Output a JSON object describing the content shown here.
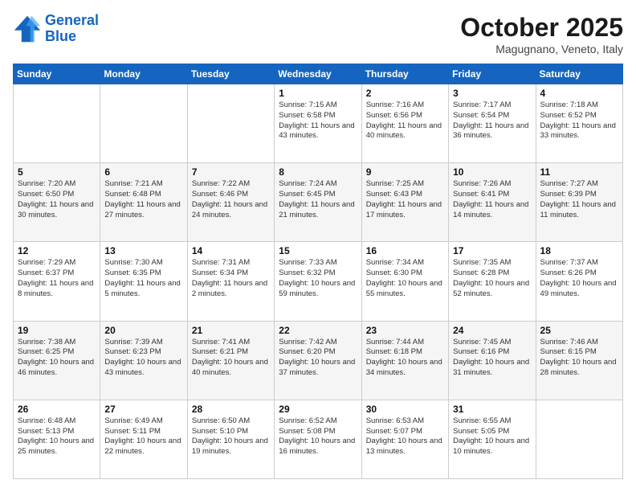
{
  "header": {
    "logo_line1": "General",
    "logo_line2": "Blue",
    "month": "October 2025",
    "location": "Magugnano, Veneto, Italy"
  },
  "weekdays": [
    "Sunday",
    "Monday",
    "Tuesday",
    "Wednesday",
    "Thursday",
    "Friday",
    "Saturday"
  ],
  "weeks": [
    [
      {
        "day": "",
        "sunrise": "",
        "sunset": "",
        "daylight": ""
      },
      {
        "day": "",
        "sunrise": "",
        "sunset": "",
        "daylight": ""
      },
      {
        "day": "",
        "sunrise": "",
        "sunset": "",
        "daylight": ""
      },
      {
        "day": "1",
        "sunrise": "7:15 AM",
        "sunset": "6:58 PM",
        "daylight": "11 hours and 43 minutes."
      },
      {
        "day": "2",
        "sunrise": "7:16 AM",
        "sunset": "6:56 PM",
        "daylight": "11 hours and 40 minutes."
      },
      {
        "day": "3",
        "sunrise": "7:17 AM",
        "sunset": "6:54 PM",
        "daylight": "11 hours and 36 minutes."
      },
      {
        "day": "4",
        "sunrise": "7:18 AM",
        "sunset": "6:52 PM",
        "daylight": "11 hours and 33 minutes."
      }
    ],
    [
      {
        "day": "5",
        "sunrise": "7:20 AM",
        "sunset": "6:50 PM",
        "daylight": "11 hours and 30 minutes."
      },
      {
        "day": "6",
        "sunrise": "7:21 AM",
        "sunset": "6:48 PM",
        "daylight": "11 hours and 27 minutes."
      },
      {
        "day": "7",
        "sunrise": "7:22 AM",
        "sunset": "6:46 PM",
        "daylight": "11 hours and 24 minutes."
      },
      {
        "day": "8",
        "sunrise": "7:24 AM",
        "sunset": "6:45 PM",
        "daylight": "11 hours and 21 minutes."
      },
      {
        "day": "9",
        "sunrise": "7:25 AM",
        "sunset": "6:43 PM",
        "daylight": "11 hours and 17 minutes."
      },
      {
        "day": "10",
        "sunrise": "7:26 AM",
        "sunset": "6:41 PM",
        "daylight": "11 hours and 14 minutes."
      },
      {
        "day": "11",
        "sunrise": "7:27 AM",
        "sunset": "6:39 PM",
        "daylight": "11 hours and 11 minutes."
      }
    ],
    [
      {
        "day": "12",
        "sunrise": "7:29 AM",
        "sunset": "6:37 PM",
        "daylight": "11 hours and 8 minutes."
      },
      {
        "day": "13",
        "sunrise": "7:30 AM",
        "sunset": "6:35 PM",
        "daylight": "11 hours and 5 minutes."
      },
      {
        "day": "14",
        "sunrise": "7:31 AM",
        "sunset": "6:34 PM",
        "daylight": "11 hours and 2 minutes."
      },
      {
        "day": "15",
        "sunrise": "7:33 AM",
        "sunset": "6:32 PM",
        "daylight": "10 hours and 59 minutes."
      },
      {
        "day": "16",
        "sunrise": "7:34 AM",
        "sunset": "6:30 PM",
        "daylight": "10 hours and 55 minutes."
      },
      {
        "day": "17",
        "sunrise": "7:35 AM",
        "sunset": "6:28 PM",
        "daylight": "10 hours and 52 minutes."
      },
      {
        "day": "18",
        "sunrise": "7:37 AM",
        "sunset": "6:26 PM",
        "daylight": "10 hours and 49 minutes."
      }
    ],
    [
      {
        "day": "19",
        "sunrise": "7:38 AM",
        "sunset": "6:25 PM",
        "daylight": "10 hours and 46 minutes."
      },
      {
        "day": "20",
        "sunrise": "7:39 AM",
        "sunset": "6:23 PM",
        "daylight": "10 hours and 43 minutes."
      },
      {
        "day": "21",
        "sunrise": "7:41 AM",
        "sunset": "6:21 PM",
        "daylight": "10 hours and 40 minutes."
      },
      {
        "day": "22",
        "sunrise": "7:42 AM",
        "sunset": "6:20 PM",
        "daylight": "10 hours and 37 minutes."
      },
      {
        "day": "23",
        "sunrise": "7:44 AM",
        "sunset": "6:18 PM",
        "daylight": "10 hours and 34 minutes."
      },
      {
        "day": "24",
        "sunrise": "7:45 AM",
        "sunset": "6:16 PM",
        "daylight": "10 hours and 31 minutes."
      },
      {
        "day": "25",
        "sunrise": "7:46 AM",
        "sunset": "6:15 PM",
        "daylight": "10 hours and 28 minutes."
      }
    ],
    [
      {
        "day": "26",
        "sunrise": "6:48 AM",
        "sunset": "5:13 PM",
        "daylight": "10 hours and 25 minutes."
      },
      {
        "day": "27",
        "sunrise": "6:49 AM",
        "sunset": "5:11 PM",
        "daylight": "10 hours and 22 minutes."
      },
      {
        "day": "28",
        "sunrise": "6:50 AM",
        "sunset": "5:10 PM",
        "daylight": "10 hours and 19 minutes."
      },
      {
        "day": "29",
        "sunrise": "6:52 AM",
        "sunset": "5:08 PM",
        "daylight": "10 hours and 16 minutes."
      },
      {
        "day": "30",
        "sunrise": "6:53 AM",
        "sunset": "5:07 PM",
        "daylight": "10 hours and 13 minutes."
      },
      {
        "day": "31",
        "sunrise": "6:55 AM",
        "sunset": "5:05 PM",
        "daylight": "10 hours and 10 minutes."
      },
      {
        "day": "",
        "sunrise": "",
        "sunset": "",
        "daylight": ""
      }
    ]
  ]
}
